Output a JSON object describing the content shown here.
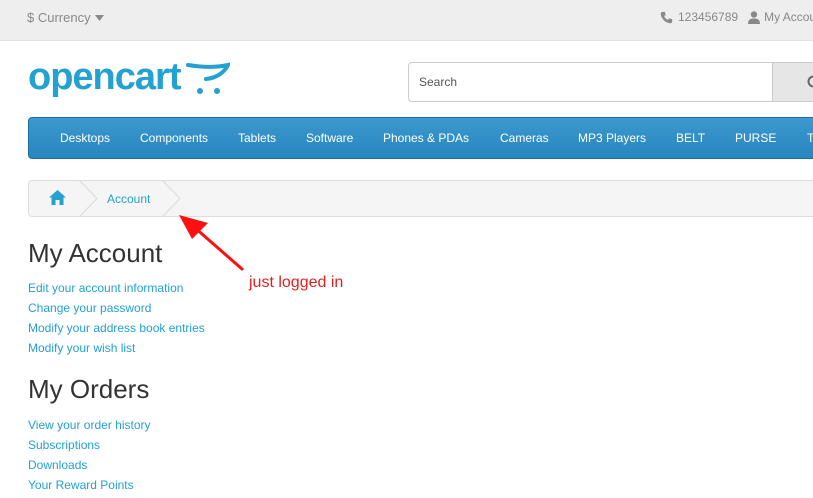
{
  "topbar": {
    "currency_label": "$ Currency",
    "phone": "123456789",
    "my_account": "My Account"
  },
  "header": {
    "logo_text": "opencart",
    "search_placeholder": "Search"
  },
  "menu": {
    "items": [
      "Desktops",
      "Components",
      "Tablets",
      "Software",
      "Phones & PDAs",
      "Cameras",
      "MP3 Players",
      "BELT",
      "PURSE",
      "T"
    ]
  },
  "breadcrumb": {
    "account": "Account"
  },
  "my_account": {
    "title": "My Account",
    "links": [
      "Edit your account information",
      "Change your password",
      "Modify your address book entries",
      "Modify your wish list"
    ]
  },
  "my_orders": {
    "title": "My Orders",
    "links": [
      "View your order history",
      "Subscriptions",
      "Downloads",
      "Your Reward Points"
    ]
  },
  "annotation": {
    "text": "just logged in",
    "color": "#e02020"
  },
  "colors": {
    "brand": "#23a1d1",
    "menu": "#2985be"
  }
}
